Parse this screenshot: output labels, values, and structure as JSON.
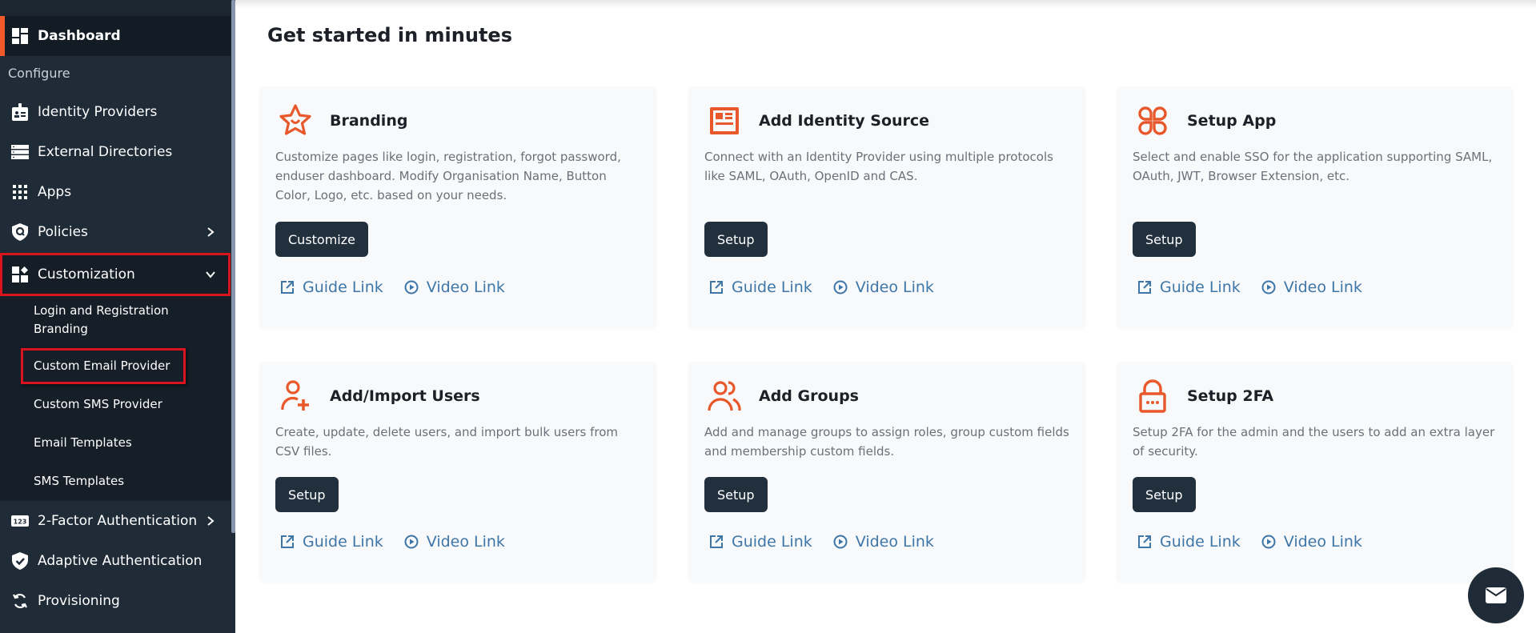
{
  "sidebar": {
    "dashboard": {
      "label": "Dashboard",
      "icon": "dashboard-icon"
    },
    "section_label": "Configure",
    "items": [
      {
        "label": "Identity Providers",
        "icon": "id-badge-icon"
      },
      {
        "label": "External Directories",
        "icon": "server-list-icon"
      },
      {
        "label": "Apps",
        "icon": "apps-grid-icon"
      },
      {
        "label": "Policies",
        "icon": "shield-search-icon",
        "chevron": "chevron-right"
      },
      {
        "label": "Customization",
        "icon": "customization-icon",
        "chevron": "chevron-down",
        "expanded": true,
        "highlighted": true
      },
      {
        "label": "2-Factor Authentication",
        "icon": "123-icon",
        "chevron": "chevron-right"
      },
      {
        "label": "Adaptive Authentication",
        "icon": "shield-check-icon"
      },
      {
        "label": "Provisioning",
        "icon": "sync-icon"
      }
    ],
    "submenu": [
      {
        "label": "Login and Registration Branding"
      },
      {
        "label": "Custom Email Provider",
        "highlighted": true
      },
      {
        "label": "Custom SMS Provider"
      },
      {
        "label": "Email Templates"
      },
      {
        "label": "SMS Templates"
      }
    ]
  },
  "main": {
    "title": "Get started in minutes",
    "cards": [
      {
        "title": "Branding",
        "icon": "star-smile-icon",
        "description": "Customize pages like login, registration, forgot password, enduser dashboard. Modify Organisation Name, Button Color, Logo, etc. based on your needs.",
        "button": "Customize",
        "guide_link": "Guide Link",
        "video_link": "Video Link"
      },
      {
        "title": "Add Identity Source",
        "icon": "id-card-icon",
        "description": "Connect with an Identity Provider using multiple protocols like SAML, OAuth, OpenID and CAS.",
        "button": "Setup",
        "guide_link": "Guide Link",
        "video_link": "Video Link"
      },
      {
        "title": "Setup App",
        "icon": "app-clover-icon",
        "description": "Select and enable SSO for the application supporting SAML, OAuth, JWT, Browser Extension, etc.",
        "button": "Setup",
        "guide_link": "Guide Link",
        "video_link": "Video Link"
      },
      {
        "title": "Add/Import Users",
        "icon": "user-plus-icon",
        "description": "Create, update, delete users, and import bulk users from CSV files.",
        "button": "Setup",
        "guide_link": "Guide Link",
        "video_link": "Video Link"
      },
      {
        "title": "Add Groups",
        "icon": "users-group-icon",
        "description": "Add and manage groups to assign roles, group custom fields and membership custom fields.",
        "button": "Setup",
        "guide_link": "Guide Link",
        "video_link": "Video Link"
      },
      {
        "title": "Setup 2FA",
        "icon": "lock-icon",
        "description": "Setup 2FA for the admin and the users to add an extra layer of security.",
        "button": "Setup",
        "guide_link": "Guide Link",
        "video_link": "Video Link"
      }
    ]
  },
  "fab": {
    "icon": "mail-icon"
  },
  "colors": {
    "accent": "#f0592a",
    "sidebar_bg": "#1f2b37",
    "highlight_border": "#d9141c",
    "button_bg": "#22303e",
    "link": "#3e76a8"
  }
}
